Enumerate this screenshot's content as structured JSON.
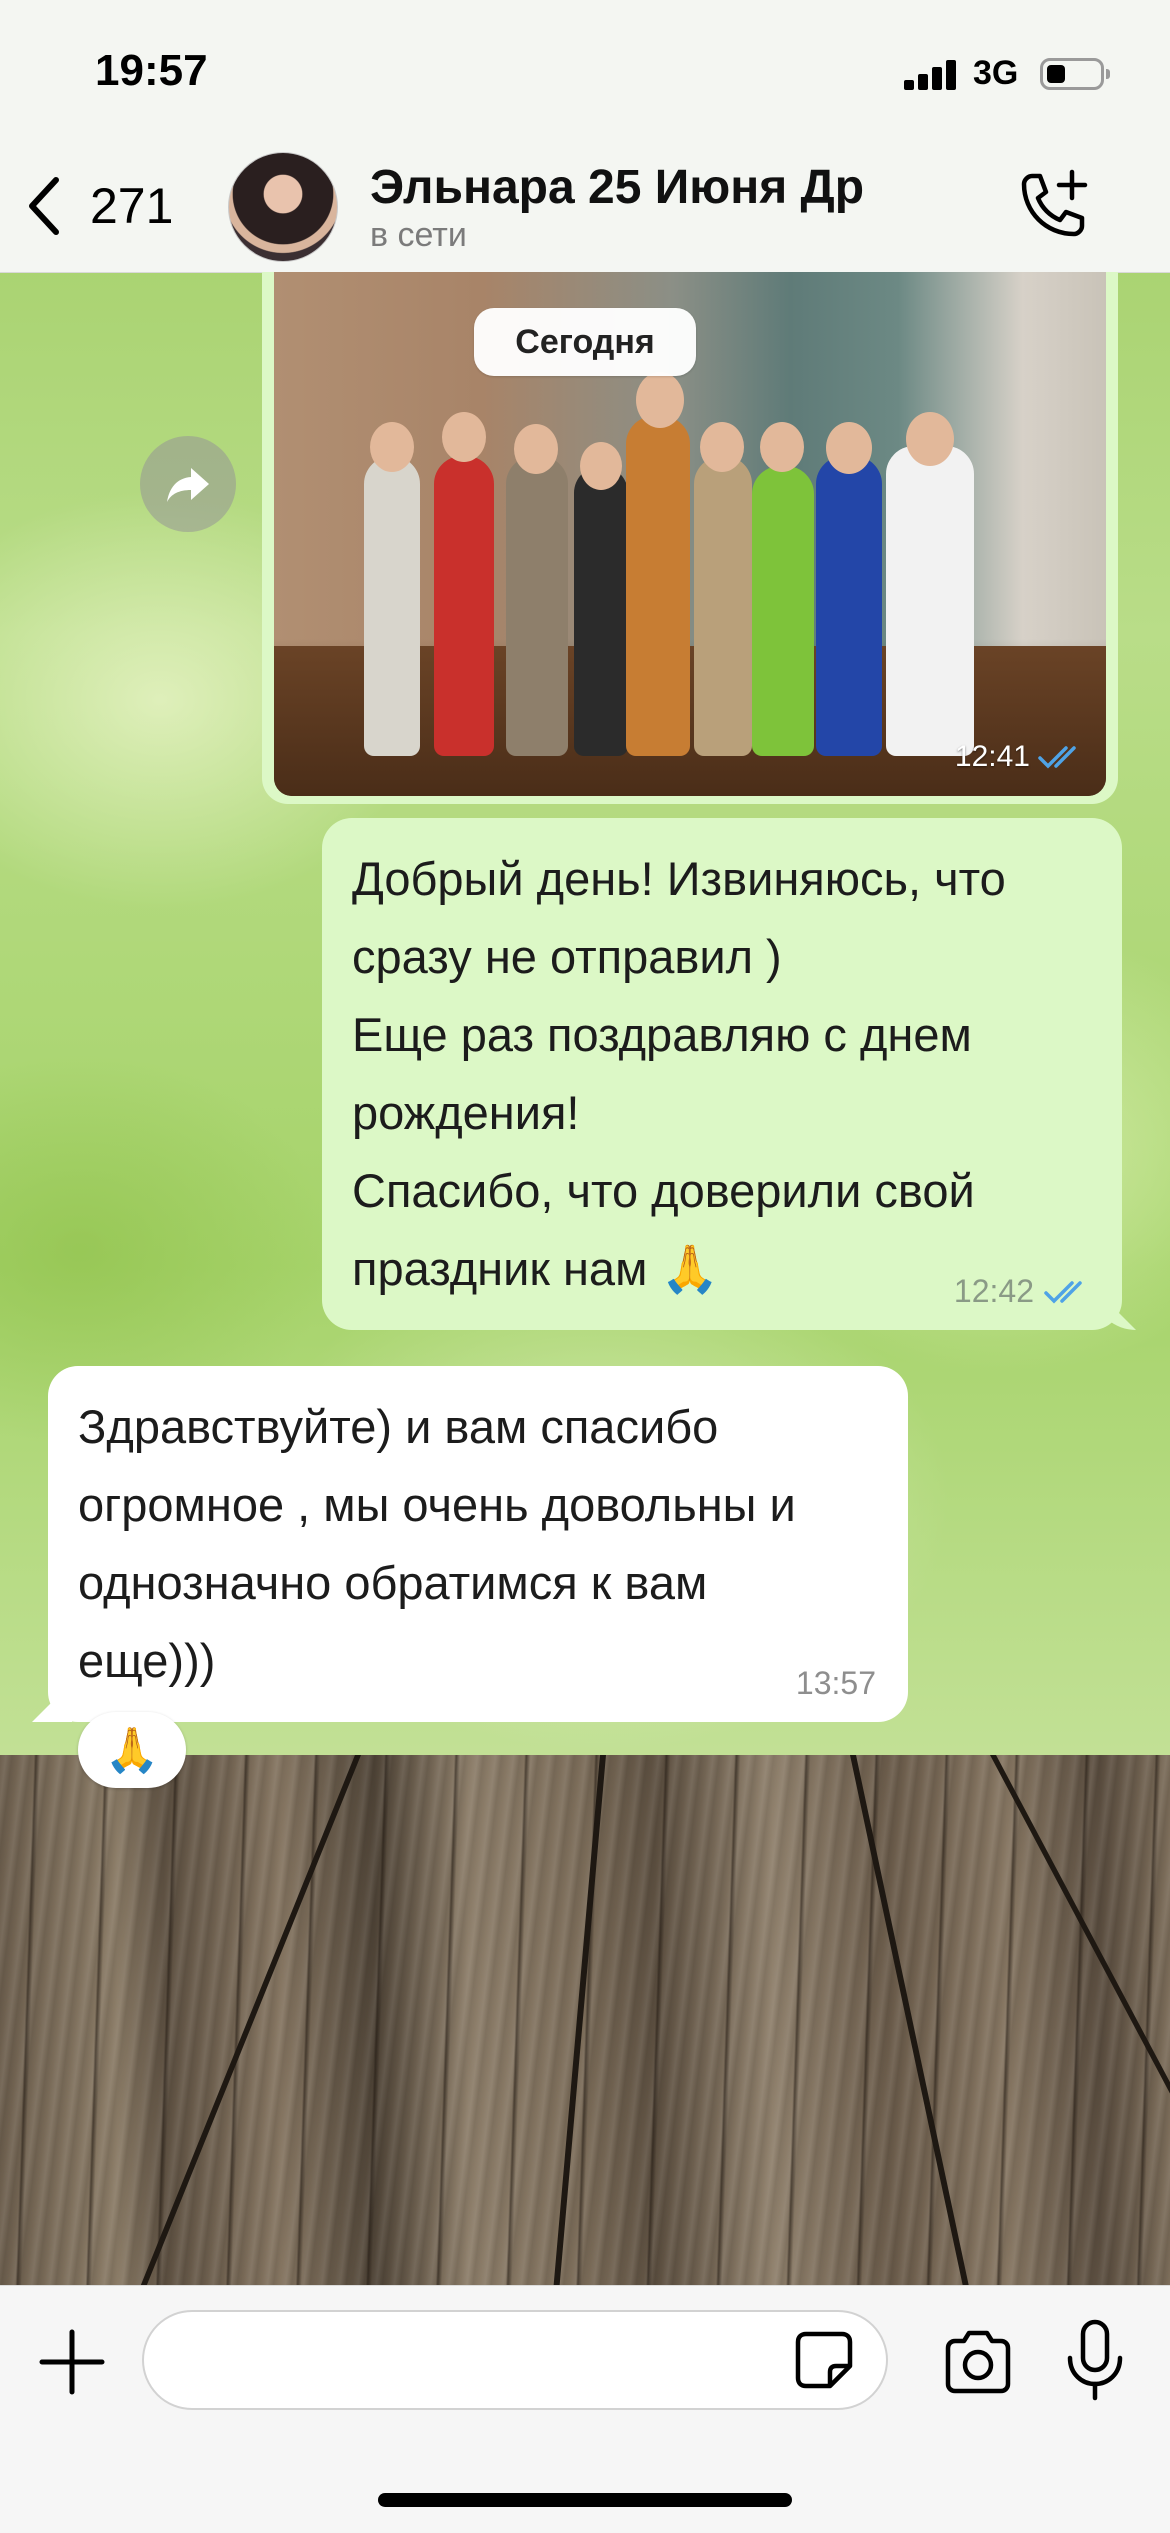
{
  "status_bar": {
    "time": "19:57",
    "network": "3G"
  },
  "header": {
    "back_count": "271",
    "title": "Эльнара 25 Июня Др",
    "subtitle": "в сети"
  },
  "date_separator": "Сегодня",
  "messages": [
    {
      "type": "photo",
      "direction": "outgoing",
      "time": "12:41",
      "status": "read"
    },
    {
      "type": "text",
      "direction": "outgoing",
      "lines": [
        "Добрый день! Извиняюсь, что",
        "сразу не отправил )",
        "Еще раз поздравляю с днем",
        "рождения!",
        "Спасибо, что доверили свой",
        "праздник нам 🙏"
      ],
      "time": "12:42",
      "status": "read"
    },
    {
      "type": "text",
      "direction": "incoming",
      "lines": [
        "Здравствуйте) и вам спасибо",
        "огромное , мы очень довольны и",
        "однозначно обратимся к вам",
        "еще)))"
      ],
      "time": "13:57",
      "reaction": "🙏"
    }
  ],
  "input": {
    "value": "",
    "placeholder": ""
  },
  "icons": {
    "back": "chevron-left-icon",
    "call": "phone-plus-icon",
    "forward": "forward-arrow-icon",
    "attach": "plus-icon",
    "sticker": "sticker-icon",
    "camera": "camera-icon",
    "mic": "microphone-icon",
    "read_ticks": "double-check-icon"
  },
  "colors": {
    "outgoing_bubble": "#dcf8c6",
    "incoming_bubble": "#ffffff",
    "read_tick": "#4fa3e6"
  }
}
